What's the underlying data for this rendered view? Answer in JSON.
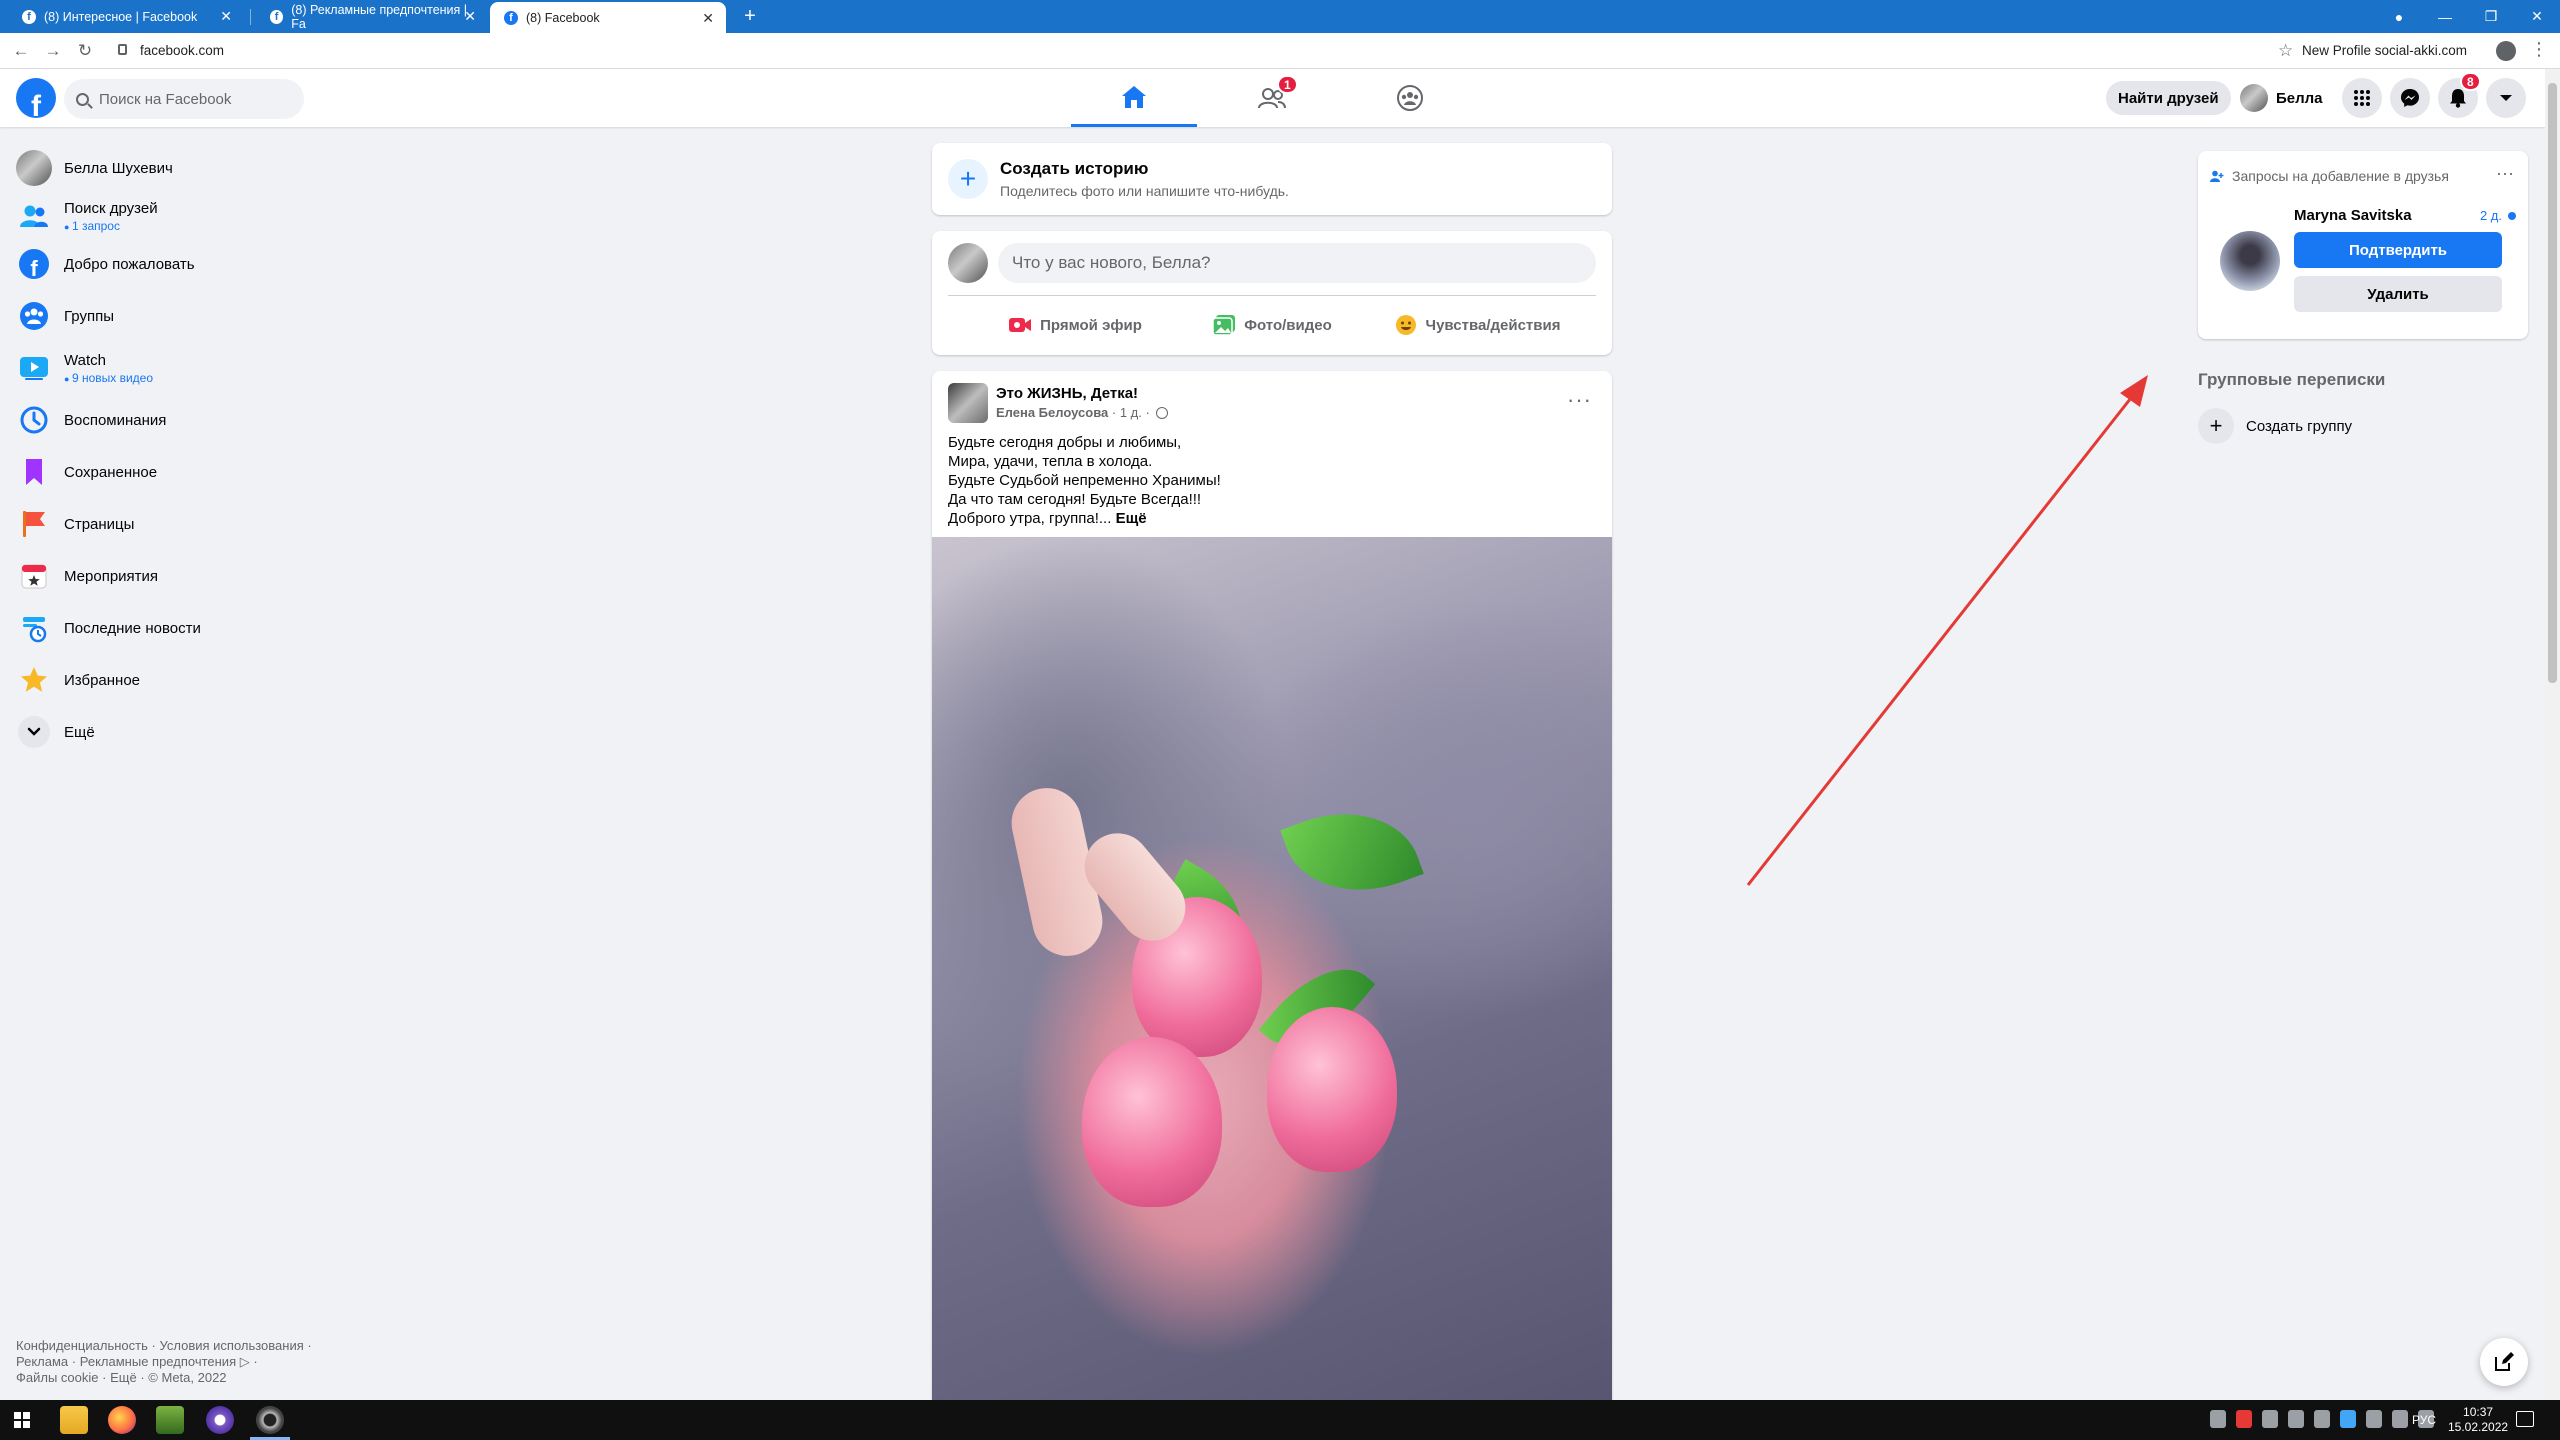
{
  "browser": {
    "tabs": [
      {
        "title": "(8) Интересное | Facebook"
      },
      {
        "title": "(8) Рекламные предпочтения | Fa"
      },
      {
        "title": "(8) Facebook"
      }
    ],
    "url": "facebook.com",
    "profile_label": "New Profile social-akki.com"
  },
  "header": {
    "logo": "f",
    "search_placeholder": "Поиск на Facebook",
    "friends_badge": "1",
    "find_friends_label": "Найти друзей",
    "user_name": "Белла",
    "notifications_badge": "8"
  },
  "sidebar": {
    "items": [
      {
        "label": "Белла Шухевич",
        "icon": "avatar"
      },
      {
        "label": "Поиск друзей",
        "sub": "1 запрос",
        "icon": "friends-icon"
      },
      {
        "label": "Добро пожаловать",
        "icon": "facebook-icon"
      },
      {
        "label": "Группы",
        "icon": "groups-icon"
      },
      {
        "label": "Watch",
        "sub": "9 новых видео",
        "icon": "watch-icon"
      },
      {
        "label": "Воспоминания",
        "icon": "memories-icon"
      },
      {
        "label": "Сохраненное",
        "icon": "saved-icon"
      },
      {
        "label": "Страницы",
        "icon": "pages-icon"
      },
      {
        "label": "Мероприятия",
        "icon": "events-icon"
      },
      {
        "label": "Последние новости",
        "icon": "news-icon"
      },
      {
        "label": "Избранное",
        "icon": "favorites-icon"
      },
      {
        "label": "Ещё",
        "icon": "chevron-down-icon"
      }
    ],
    "footer": {
      "privacy": "Конфиденциальность",
      "terms": "Условия использования",
      "ads": "Реклама",
      "ad_choices": "Рекламные предпочтения",
      "cookies": "Файлы cookie",
      "more": "Ещё",
      "copyright": "© Meta, 2022",
      "sep": "·"
    }
  },
  "feed": {
    "story": {
      "title": "Создать историю",
      "subtitle": "Поделитесь фото или напишите что-нибудь."
    },
    "composer": {
      "placeholder": "Что у вас нового, Белла?",
      "live_label": "Прямой эфир",
      "photo_label": "Фото/видео",
      "feeling_label": "Чувства/действия"
    },
    "post": {
      "group": "Это ЖИЗНЬ, Детка!",
      "author": "Елена Белоусова",
      "time": "1 д.",
      "lines": [
        "Будьте сегодня добры и любимы,",
        "Мира, удачи, тепла в холода.",
        "Будьте Судьбой непременно Хранимы!",
        "Да что там сегодня! Будьте Всегда!!!",
        "Доброго утра, группа!..."
      ],
      "more_label": "Ещё"
    }
  },
  "right": {
    "requests": {
      "title": "Запросы на добавление в друзья",
      "name": "Maryna Savitska",
      "time": "2 д.",
      "confirm_label": "Подтвердить",
      "delete_label": "Удалить"
    },
    "group_chats_title": "Групповые переписки",
    "create_group_label": "Создать группу"
  },
  "taskbar": {
    "lang": "РУС",
    "time": "10:37",
    "date": "15.02.2022"
  },
  "colors": {
    "brand": "#1877f2",
    "badge": "#e41e3f",
    "annotation_arrow": "#e53935"
  }
}
